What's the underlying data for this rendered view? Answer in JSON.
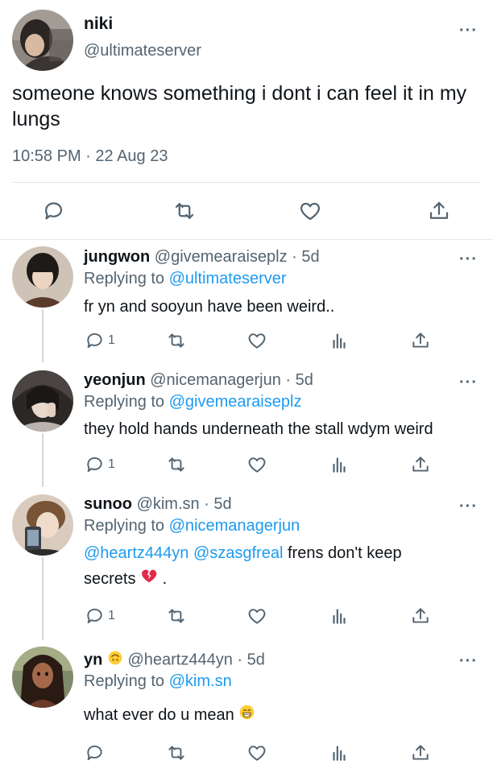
{
  "main": {
    "name": "niki",
    "handle": "@ultimateserver",
    "text": "someone knows something i dont i can feel it in my lungs",
    "timestamp": "10:58 PM · 22 Aug 23",
    "more": "···"
  },
  "replies": [
    {
      "name": "jungwon",
      "handle": "@givemearaiseplz · 5d",
      "replying_prefix": "Replying to ",
      "replying_to": "@ultimateserver",
      "text": "fr yn and sooyun have been weird..",
      "reply_count": "1",
      "more": "···"
    },
    {
      "name": "yeonjun",
      "handle": "@nicemanagerjun · 5d",
      "replying_prefix": "Replying to ",
      "replying_to": "@givemearaiseplz",
      "text": "they hold hands underneath the stall wdym weird",
      "reply_count": "1",
      "more": "···"
    },
    {
      "name": "sunoo",
      "handle": "@kim.sn · 5d",
      "replying_prefix": "Replying to ",
      "replying_to": "@nicemanagerjun",
      "mention1": "@heartz444yn",
      "mention2": "@szasgfreal",
      "text_after": " frens don't keep",
      "text_line2": "secrets",
      "text_line2_end": " .",
      "emoji": "broken-heart",
      "reply_count": "1",
      "more": "···"
    },
    {
      "name": "yn",
      "name_emoji": "upside-down-face",
      "handle": "@heartz444yn · 5d",
      "replying_prefix": "Replying to ",
      "replying_to": "@kim.sn",
      "text": "what ever do u mean",
      "emoji": "grinning-face",
      "more": "···"
    }
  ],
  "colors": {
    "link": "#1d9bf0",
    "secondary_text": "#536471",
    "primary_text": "#0f1419",
    "divider": "#e3e7ea"
  }
}
